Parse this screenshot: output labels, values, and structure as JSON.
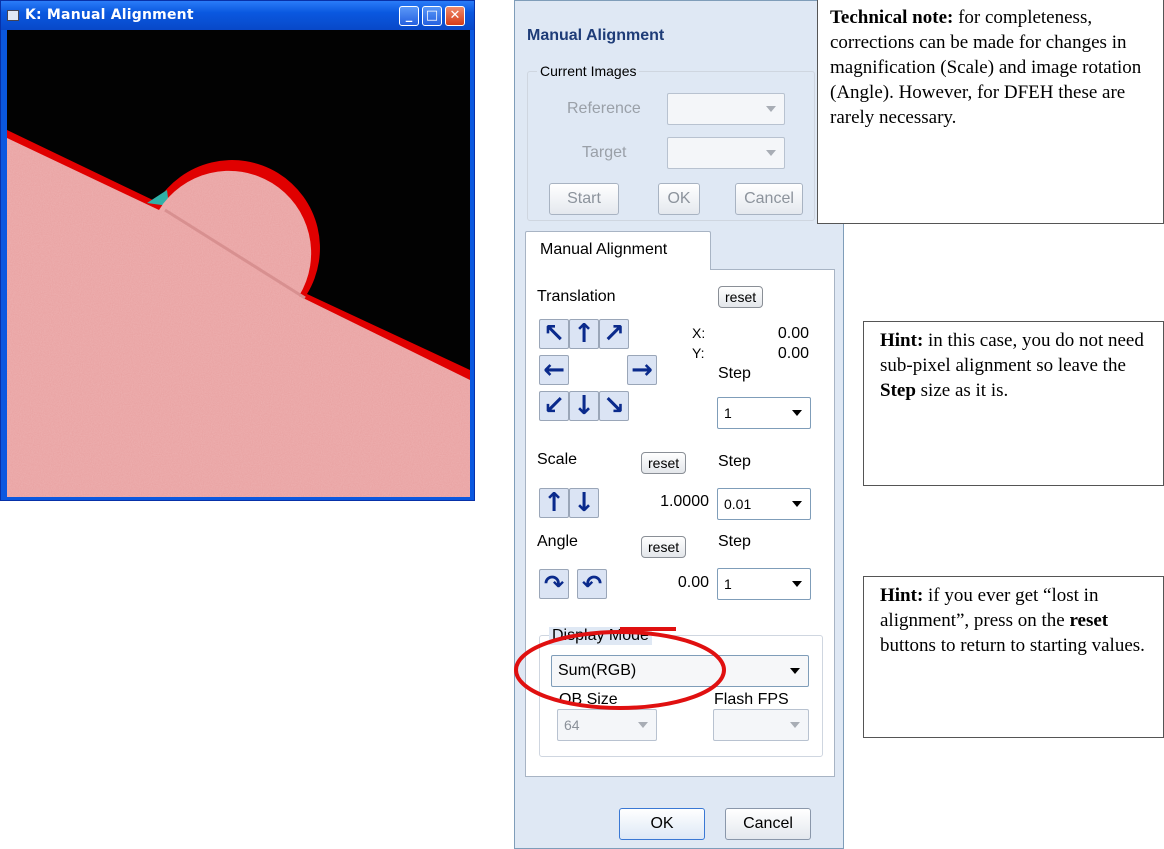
{
  "image_window": {
    "title": "K: Manual Alignment",
    "minimize_glyph": "_",
    "maximize_glyph": "□",
    "close_glyph": "✕"
  },
  "dialog": {
    "title": "Manual Alignment",
    "current_images": {
      "group_label": "Current Images",
      "reference_label": "Reference",
      "reference_value": "",
      "target_label": "Target",
      "target_value": "",
      "start_button": "Start",
      "ok_button": "OK",
      "cancel_button": "Cancel"
    },
    "tab_label": "Manual Alignment",
    "translation": {
      "label": "Translation",
      "reset_button": "reset",
      "x_label": "X:",
      "x_value": "0.00",
      "y_label": "Y:",
      "y_value": "0.00",
      "step_label": "Step",
      "step_value": "1"
    },
    "scale": {
      "label": "Scale",
      "reset_button": "reset",
      "step_label": "Step",
      "value": "1.0000",
      "step_value": "0.01"
    },
    "angle": {
      "label": "Angle",
      "reset_button": "reset",
      "step_label": "Step",
      "value": "0.00",
      "step_value": "1"
    },
    "display_mode": {
      "group_label": "Display Mode",
      "value": "Sum(RGB)",
      "ob_size_label": "OB Size",
      "ob_size_value": "64",
      "flash_fps_label": "Flash FPS",
      "flash_fps_value": ""
    },
    "ok_button": "OK",
    "cancel_button": "Cancel"
  },
  "notes": {
    "technical": {
      "bold": "Technical note:",
      "text": " for completeness, corrections can be made for changes in magnification (Scale) and image rotation (Angle). However, for DFEH these are rarely necessary."
    },
    "hint_step": {
      "bold": "Hint:",
      "text1": " in this case, you do not need sub-pixel alignment so leave the ",
      "bold2": "Step",
      "text2": " size as it is."
    },
    "hint_reset": {
      "bold": "Hint:",
      "text1": " if you ever get “lost in alignment”, press on the ",
      "bold2": "reset",
      "text2": " buttons to return to starting values."
    }
  },
  "colors": {
    "titlebar_blue": "#0a58e0",
    "dialog_bg": "#dfe8f4",
    "arrow_blue": "#0a2a8c",
    "highlight_red": "#e01010"
  },
  "icons": {
    "up_left": "up-left-arrow-icon",
    "up": "up-arrow-icon",
    "up_right": "up-right-arrow-icon",
    "left": "left-arrow-icon",
    "right": "right-arrow-icon",
    "down_left": "down-left-arrow-icon",
    "down": "down-arrow-icon",
    "down_right": "down-right-arrow-icon",
    "rotate_cw": "rotate-clockwise-icon",
    "rotate_ccw": "rotate-counterclockwise-icon"
  }
}
